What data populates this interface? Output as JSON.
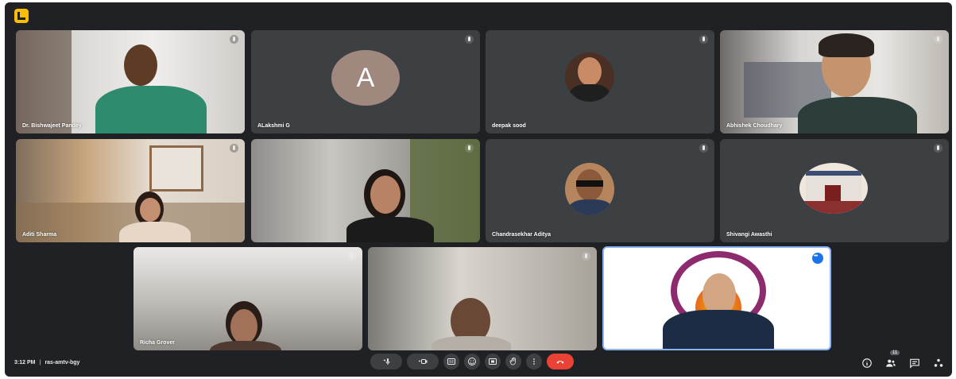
{
  "app": {
    "logo_icon": "meet-logo-icon"
  },
  "participants": [
    {
      "name": "Dr. Bishwajeet Pandey",
      "type": "video"
    },
    {
      "name": "ALakshmi G",
      "type": "letter",
      "letter": "A",
      "avatar_color": "#a1887f"
    },
    {
      "name": "deepak sood",
      "type": "photo"
    },
    {
      "name": "Abhishek Choudhary",
      "type": "video"
    },
    {
      "name": "Aditi Sharma",
      "type": "video"
    },
    {
      "name": "",
      "type": "video"
    },
    {
      "name": "Chandrasekhar Aditya",
      "type": "photo"
    },
    {
      "name": "Shivangi Awasthi",
      "type": "photo"
    },
    {
      "name": "Richa Grover",
      "type": "video"
    },
    {
      "name": "",
      "type": "video"
    },
    {
      "name": "",
      "type": "video",
      "active_speaker": true
    }
  ],
  "bottom_bar": {
    "time": "3:12 PM",
    "meeting_code": "ras-amtv-bgy",
    "people_count": "11"
  },
  "controls": [
    {
      "name": "mic-button",
      "icon": "mic-icon"
    },
    {
      "name": "camera-button",
      "icon": "camera-icon"
    },
    {
      "name": "captions-button",
      "icon": "captions-icon"
    },
    {
      "name": "reactions-button",
      "icon": "emoji-icon"
    },
    {
      "name": "present-button",
      "icon": "present-icon"
    },
    {
      "name": "raise-hand-button",
      "icon": "hand-icon"
    },
    {
      "name": "more-options-button",
      "icon": "more-vert-icon"
    },
    {
      "name": "leave-call-button",
      "icon": "call-end-icon"
    }
  ],
  "colors": {
    "background": "#202124",
    "tile": "#3c4043",
    "end_call": "#ea4335",
    "active_speaker": "#1a73e8",
    "logo": "#fbbc04"
  }
}
